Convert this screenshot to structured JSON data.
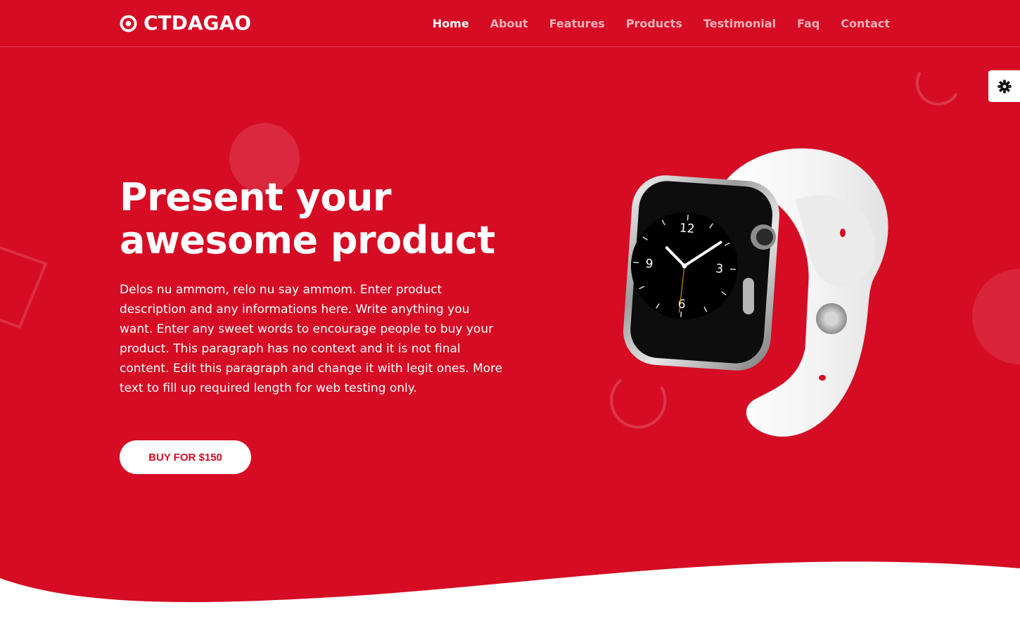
{
  "brand": {
    "name": "CTDAGAO",
    "logo_icon": "target-icon"
  },
  "nav": {
    "items": [
      {
        "label": "Home",
        "active": true
      },
      {
        "label": "About",
        "active": false
      },
      {
        "label": "Features",
        "active": false
      },
      {
        "label": "Products",
        "active": false
      },
      {
        "label": "Testimonial",
        "active": false
      },
      {
        "label": "Faq",
        "active": false
      },
      {
        "label": "Contact",
        "active": false
      }
    ]
  },
  "settings": {
    "icon": "gear-icon"
  },
  "hero": {
    "headline_line1": "Present your",
    "headline_line2": "awesome product",
    "description": "Delos nu ammom, relo nu say ammom. Enter product description and any informations here. Write anything you want. Enter any sweet words to encourage people to buy your product. This paragraph has no context and it is not final content. Edit this paragraph and change it with legit ones. More text to fill up required length for web testing only.",
    "cta_label": "BUY FOR $150"
  },
  "watch_face": {
    "numerals": [
      "12",
      "3",
      "6",
      "9"
    ]
  },
  "colors": {
    "accent": "#d50c24",
    "text": "#ffffff",
    "button_bg": "#ffffff"
  }
}
